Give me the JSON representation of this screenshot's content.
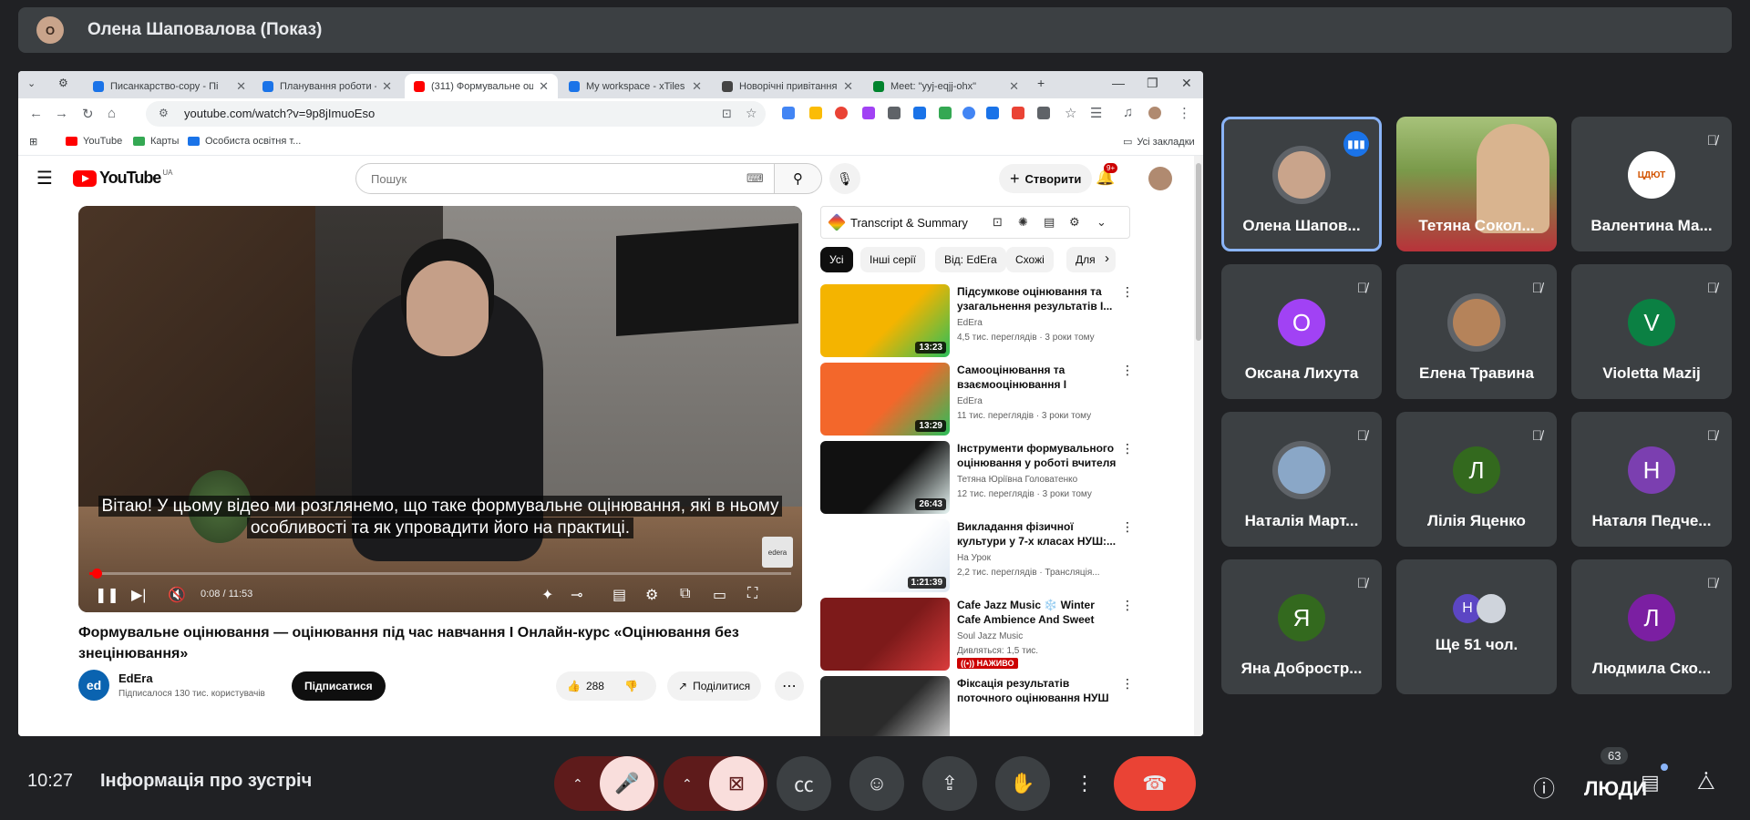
{
  "presenter": {
    "initial": "О",
    "label": "Олена Шаповалова (Показ)"
  },
  "browser": {
    "tabs": [
      {
        "title": "Писанкарство-copy - Пі",
        "color": "#1a73e8"
      },
      {
        "title": "Планування роботи - Пі",
        "color": "#1a73e8"
      },
      {
        "title": "(311) Формувальне оцін",
        "color": "#ff0000"
      },
      {
        "title": "My workspace - xTiles",
        "color": "#1a73e8"
      },
      {
        "title": "Новорічні привітання",
        "color": "#444444"
      },
      {
        "title": "Meet: \"yyj-eqjj-ohx\"",
        "color": "#00832d"
      }
    ],
    "url": "youtube.com/watch?v=9p8jImuoEso",
    "bookmarks": [
      "YouTube",
      "Карты",
      "Особиста освітня т..."
    ],
    "all_bookmarks": "Усі закладки"
  },
  "youtube": {
    "logo": "YouTube",
    "region": "UA",
    "search_placeholder": "Пошук",
    "create": "Створити",
    "notif_badge": "9+",
    "subtitle": "Вітаю! У цьому відео ми розглянемо, що таке формувальне оцінювання, які в ньому особливості та як упровадити його на практиці.",
    "watermark": "edera",
    "progress_fraction": 0.011,
    "time": "0:08 / 11:53",
    "title": "Формувальне оцінювання — оцінювання під час навчання І Онлайн-курс «Оцінювання без знецінювання»",
    "channel": {
      "initial": "ed",
      "name": "EdEra",
      "subs": "Підписалося 130 тис. користувачів"
    },
    "subscribe": "Підписатися",
    "likes": "288",
    "share": "Поділитися",
    "ts_title": "Transcript & Summary",
    "chips": [
      "Усі",
      "Інші серії",
      "Від: EdEra",
      "Схожі",
      "Для"
    ],
    "recs": [
      {
        "title": "Підсумкове оцінювання та узагальнення результатів І...",
        "channel": "EdEra",
        "meta": "4,5 тис. переглядів · 3 роки тому",
        "duration": "13:23",
        "thumb": "#f4b400",
        "thumb2": "#2bbf5a",
        "live": ""
      },
      {
        "title": "Самооцінювання та взаємооцінювання І Онлайн...",
        "channel": "EdEra",
        "meta": "11 тис. переглядів · 3 роки тому",
        "duration": "13:29",
        "thumb": "#f3672b",
        "thumb2": "#2bbf5a",
        "live": ""
      },
      {
        "title": "Інструменти формувального оцінювання у роботі вчителя",
        "channel": "Тетяна Юріївна Головатенко",
        "meta": "12 тис. переглядів · 3 роки тому",
        "duration": "26:43",
        "thumb": "#111111",
        "thumb2": "#e8f6f4",
        "live": ""
      },
      {
        "title": "Викладання фізичної культури у 7-х класах НУШ:...",
        "channel": "На Урок",
        "meta": "2,2 тис. переглядів · Трансляція...",
        "duration": "1:21:39",
        "thumb": "#ffffff",
        "thumb2": "#dfe8f2",
        "live": ""
      },
      {
        "title": "Cafe Jazz Music ❄️ Winter Cafe Ambience And Sweet Jaz...",
        "channel": "Soul Jazz Music",
        "meta": "Дивляться: 1,5 тис.",
        "duration": "",
        "thumb": "#7d1a1a",
        "thumb2": "#d93c3c",
        "live": "((•)) НАЖИВО"
      },
      {
        "title": "Фіксація результатів поточного оцінювання НУШ ...",
        "channel": "",
        "meta": "",
        "duration": "",
        "thumb": "#2b2b2b",
        "thumb2": "#dcdcdc",
        "live": ""
      }
    ]
  },
  "participants": [
    {
      "name": "Олена Шапов...",
      "initial": "",
      "color": "#c9a48b",
      "state": "speaking"
    },
    {
      "name": "Тетяна Сокол...",
      "initial": "",
      "color": "#6d8a3a",
      "state": "video"
    },
    {
      "name": "Валентина Ма...",
      "initial": "ЦДЮТ",
      "color": "#ffffff",
      "state": "muted"
    },
    {
      "name": "Оксана Лихута",
      "initial": "О",
      "color": "#a142f4",
      "state": "muted"
    },
    {
      "name": "Елена Травина",
      "initial": "",
      "color": "#b5835a",
      "state": "muted"
    },
    {
      "name": "Violetta Mazij",
      "initial": "V",
      "color": "#0b8043",
      "state": "muted"
    },
    {
      "name": "Наталія Март...",
      "initial": "",
      "color": "#8aa7c7",
      "state": "muted"
    },
    {
      "name": "Лілія Яценко",
      "initial": "Л",
      "color": "#33691e",
      "state": "muted"
    },
    {
      "name": "Наталя Педче...",
      "initial": "Н",
      "color": "#7b3fb0",
      "state": "muted"
    },
    {
      "name": "Яна Добростр...",
      "initial": "Я",
      "color": "#33691e",
      "state": "muted"
    },
    {
      "name": "Ще 51 чол.",
      "initial": "Н",
      "color": "#5c46c4",
      "state": "more"
    },
    {
      "name": "Людмила Ско...",
      "initial": "Л",
      "color": "#7b1fa2",
      "state": "muted"
    }
  ],
  "bottom": {
    "clock": "10:27",
    "meeting_info": "Інформація про зустріч",
    "people_count": "63",
    "people_label": "ЛЮДИ"
  }
}
